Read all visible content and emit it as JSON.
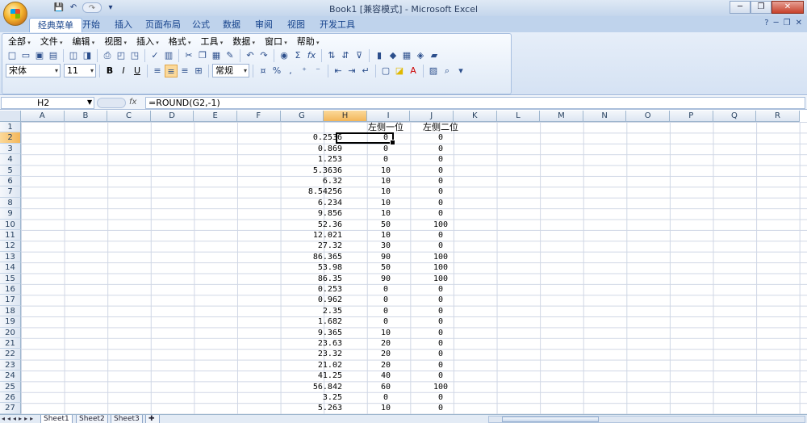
{
  "window": {
    "title": "Book1  [兼容模式] - Microsoft Excel",
    "buttons": {
      "minimize": "─",
      "restore": "❐",
      "close": "✕"
    }
  },
  "qat": {
    "save": "💾",
    "undo": "↶",
    "redo": "↷",
    "more": "▾"
  },
  "tabs": [
    "经典菜单",
    "开始",
    "插入",
    "页面布局",
    "公式",
    "数据",
    "审阅",
    "视图",
    "开发工具"
  ],
  "tabs_right": {
    "help": "?",
    "min": "─",
    "restore": "❐",
    "close": "✕"
  },
  "menus": [
    "全部",
    "文件",
    "编辑",
    "视图",
    "插入",
    "格式",
    "工具",
    "数据",
    "窗口",
    "帮助"
  ],
  "toolbar": {
    "font_name": "宋体",
    "font_size": "11",
    "bold": "B",
    "italic": "I",
    "underline": "U",
    "number_format": "常规",
    "sum": "Σ",
    "fx": "fx",
    "percent": "%"
  },
  "formula_bar": {
    "name_box": "H2",
    "fx_label": "fx",
    "formula": "=ROUND(G2,-1)"
  },
  "columns": [
    "A",
    "B",
    "C",
    "D",
    "E",
    "F",
    "G",
    "H",
    "I",
    "J",
    "K",
    "L",
    "M",
    "N",
    "O",
    "P",
    "Q",
    "R"
  ],
  "selected_column": "H",
  "selected_row": 2,
  "headers": {
    "h": "左侧一位",
    "j": "左侧二位"
  },
  "rows": [
    {
      "g": "0.2536",
      "h": "0",
      "j": "0"
    },
    {
      "g": "0.869",
      "h": "0",
      "j": "0"
    },
    {
      "g": "1.253",
      "h": "0",
      "j": "0"
    },
    {
      "g": "5.3636",
      "h": "10",
      "j": "0"
    },
    {
      "g": "6.32",
      "h": "10",
      "j": "0"
    },
    {
      "g": "8.54256",
      "h": "10",
      "j": "0"
    },
    {
      "g": "6.234",
      "h": "10",
      "j": "0"
    },
    {
      "g": "9.856",
      "h": "10",
      "j": "0"
    },
    {
      "g": "52.36",
      "h": "50",
      "j": "100"
    },
    {
      "g": "12.021",
      "h": "10",
      "j": "0"
    },
    {
      "g": "27.32",
      "h": "30",
      "j": "0"
    },
    {
      "g": "86.365",
      "h": "90",
      "j": "100"
    },
    {
      "g": "53.98",
      "h": "50",
      "j": "100"
    },
    {
      "g": "86.35",
      "h": "90",
      "j": "100"
    },
    {
      "g": "0.253",
      "h": "0",
      "j": "0"
    },
    {
      "g": "0.962",
      "h": "0",
      "j": "0"
    },
    {
      "g": "2.35",
      "h": "0",
      "j": "0"
    },
    {
      "g": "1.682",
      "h": "0",
      "j": "0"
    },
    {
      "g": "9.365",
      "h": "10",
      "j": "0"
    },
    {
      "g": "23.63",
      "h": "20",
      "j": "0"
    },
    {
      "g": "23.32",
      "h": "20",
      "j": "0"
    },
    {
      "g": "21.02",
      "h": "20",
      "j": "0"
    },
    {
      "g": "41.25",
      "h": "40",
      "j": "0"
    },
    {
      "g": "56.842",
      "h": "60",
      "j": "100"
    },
    {
      "g": "3.25",
      "h": "0",
      "j": "0"
    },
    {
      "g": "5.263",
      "h": "10",
      "j": "0"
    }
  ],
  "sheets": [
    "Sheet1",
    "Sheet2",
    "Sheet3"
  ],
  "sheet_nav": "◂◂◂▸▸▸",
  "new_sheet_icon": "new-sheet-icon"
}
